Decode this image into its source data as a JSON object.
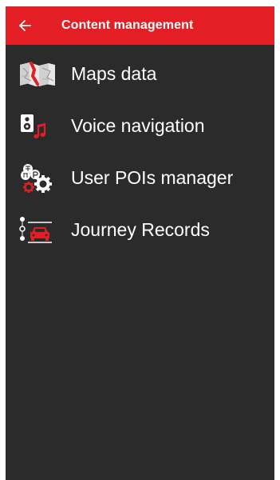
{
  "colors": {
    "appbar": "#e31e24",
    "background": "#2b2b2b",
    "text": "#ffffff"
  },
  "appbar": {
    "title": "Content management",
    "back_icon": "arrow-back-icon"
  },
  "menu": {
    "items": [
      {
        "label": "Maps data",
        "icon": "map-icon"
      },
      {
        "label": "Voice navigation",
        "icon": "speaker-music-icon"
      },
      {
        "label": "User POIs manager",
        "icon": "poi-gear-icon"
      },
      {
        "label": "Journey Records",
        "icon": "journey-car-icon"
      }
    ]
  }
}
